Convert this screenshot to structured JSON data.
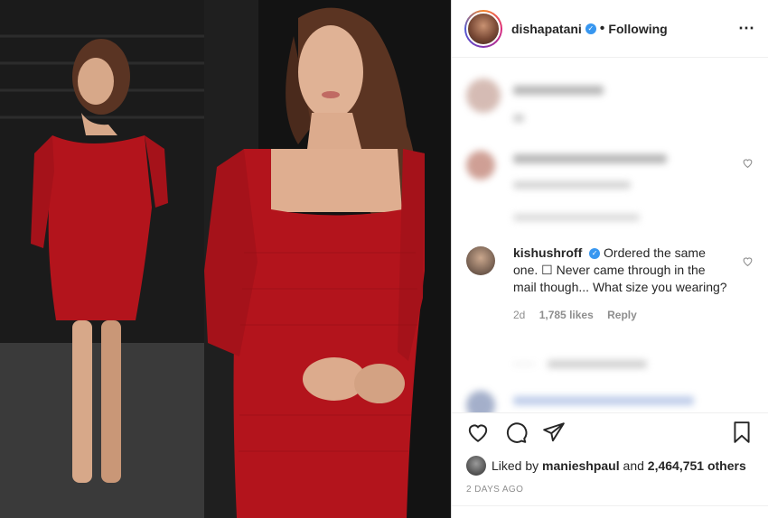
{
  "post": {
    "username": "dishapatani",
    "verified_glyph": "✓",
    "separator": "•",
    "follow_state": "Following",
    "more_icon": "⋯"
  },
  "comments": [
    {
      "blurred": true
    },
    {
      "blurred": true
    },
    {
      "username": "kishushroff",
      "verified_glyph": "✓",
      "text": "Ordered the same one. ☐ Never came through in the mail though... What size you wearing?",
      "age": "2d",
      "likes": "1,785 likes",
      "reply": "Reply"
    },
    {
      "blurred": true
    },
    {
      "blurred": true
    }
  ],
  "liked_by": {
    "prefix": "Liked by",
    "user": "manieshpaul",
    "conj": "and",
    "count": "2,464,751 others"
  },
  "timestamp": "2 DAYS AGO",
  "colors": {
    "dress_red": "#b3141c",
    "link_blue": "#3897f0",
    "meta_gray": "#8e8e8e"
  },
  "icons": [
    "heart-icon",
    "comment-icon",
    "share-icon",
    "bookmark-icon",
    "more-options-icon",
    "verified-icon"
  ]
}
